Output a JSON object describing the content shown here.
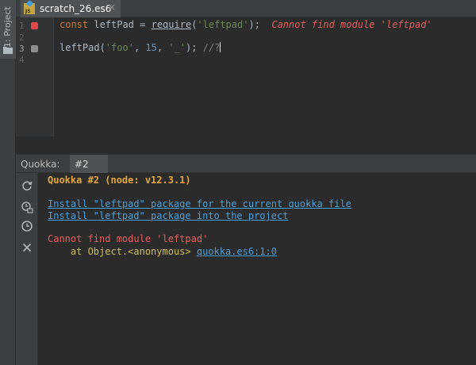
{
  "sidebar": {
    "project_label": "1: Project"
  },
  "editor_tab": {
    "filename": "scratch_26.es6",
    "icon": "js-file-icon",
    "icon_text": "JS"
  },
  "editor": {
    "line_numbers": [
      "1",
      "2",
      "3",
      "4"
    ],
    "line1": {
      "keyword": "const",
      "ident": " leftPad = ",
      "fn": "require",
      "open": "(",
      "arg": "'leftpad'",
      "close": ");",
      "error": "Cannot find module 'leftpad'"
    },
    "line3": {
      "fn": "leftPad",
      "open": "(",
      "arg1": "'foo'",
      "sep1": ", ",
      "arg2": "15",
      "sep2": ", ",
      "arg3": "'_'",
      "close": "); ",
      "comment": "//?"
    }
  },
  "panel": {
    "title": "Quokka:",
    "tab": "#2",
    "tools": [
      "refresh-icon",
      "coverage-icon",
      "history-icon",
      "close-icon"
    ]
  },
  "output": {
    "header": "Quokka #2 (node: v12.3.1)",
    "link1": "Install \"leftpad\" package for the current quokka file",
    "link2": "Install \"leftpad\" package into the project",
    "error": "Cannot find module 'leftpad'",
    "trace_prefix": "    at Object.<anonymous> ",
    "trace_link": "quokka.es6:1:0"
  },
  "colors": {
    "background": "#2b2b2b",
    "keyword": "#cc7832",
    "string": "#6a8759",
    "number": "#6897bb",
    "error": "#e45e5e",
    "link": "#4a9ed8",
    "header": "#e5a73a"
  }
}
